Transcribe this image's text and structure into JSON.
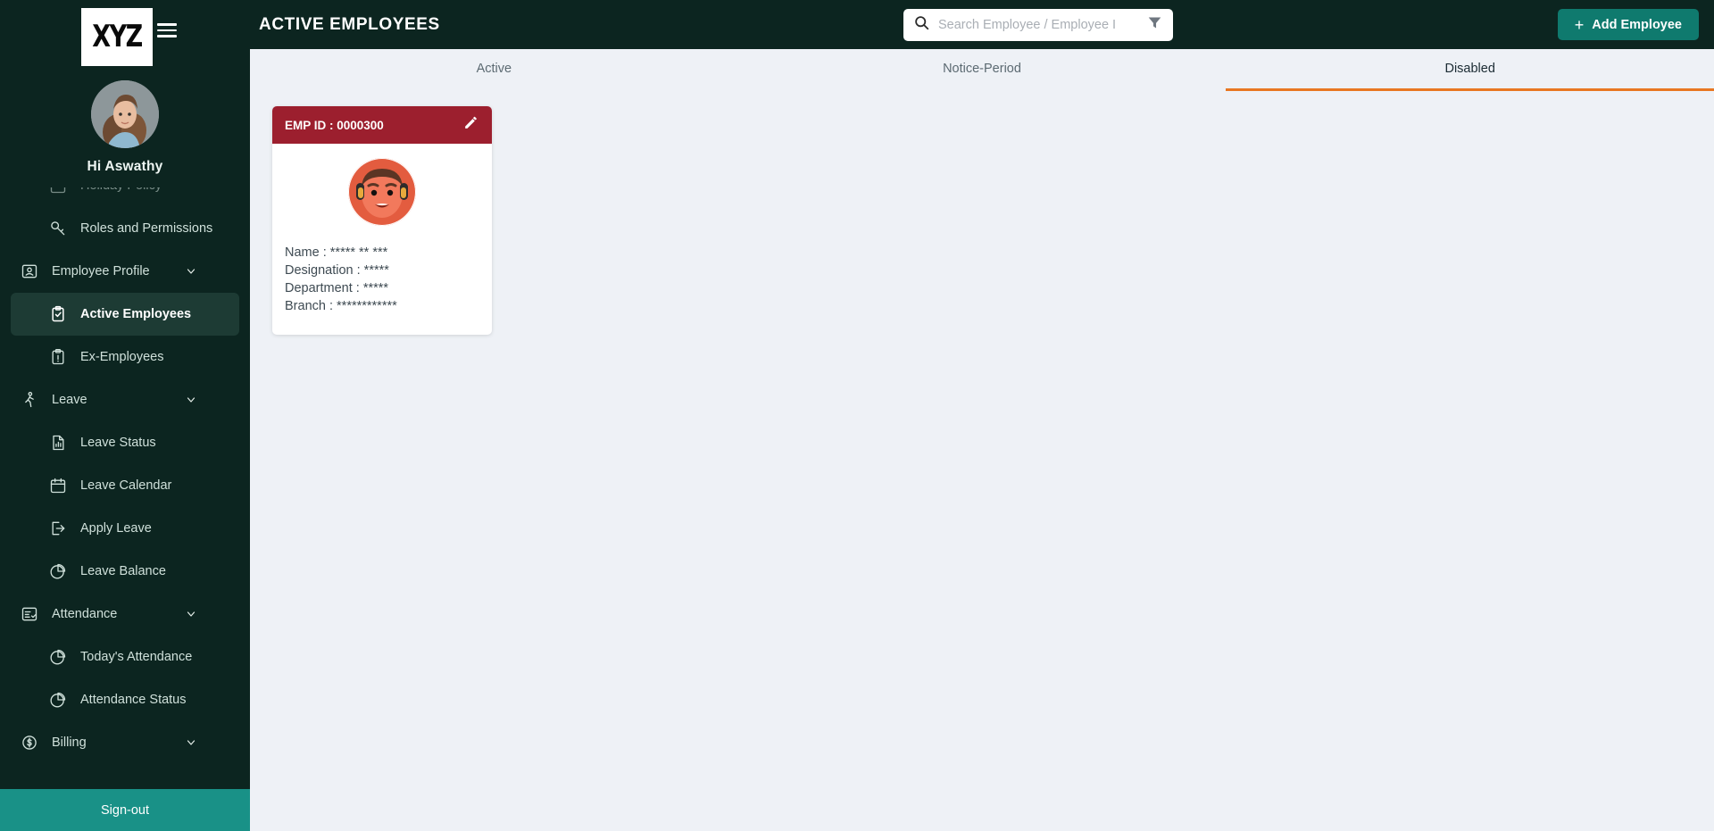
{
  "sidebar": {
    "logo_text": "XYZ",
    "menu_icon": "hamburger-icon",
    "greeting": "Hi Aswathy",
    "signout_label": "Sign-out",
    "items": [
      {
        "label": "Holiday Policy",
        "icon": "calendar-icon",
        "level": "child",
        "active": false,
        "chevron": false,
        "clipped": true
      },
      {
        "label": "Roles and Permissions",
        "icon": "key-icon",
        "level": "child",
        "active": false,
        "chevron": false
      },
      {
        "label": "Employee Profile",
        "icon": "id-card-icon",
        "level": "parent",
        "active": false,
        "chevron": true
      },
      {
        "label": "Active Employees",
        "icon": "clipboard-check-icon",
        "level": "child",
        "active": true,
        "chevron": false
      },
      {
        "label": "Ex-Employees",
        "icon": "clipboard-alert-icon",
        "level": "child",
        "active": false,
        "chevron": false
      },
      {
        "label": "Leave",
        "icon": "walking-person-icon",
        "level": "parent",
        "active": false,
        "chevron": true
      },
      {
        "label": "Leave Status",
        "icon": "document-chart-icon",
        "level": "child",
        "active": false,
        "chevron": false
      },
      {
        "label": "Leave Calendar",
        "icon": "calendar-icon",
        "level": "child",
        "active": false,
        "chevron": false
      },
      {
        "label": "Apply Leave",
        "icon": "exit-arrow-icon",
        "level": "child",
        "active": false,
        "chevron": false
      },
      {
        "label": "Leave Balance",
        "icon": "pie-chart-icon",
        "level": "child",
        "active": false,
        "chevron": false
      },
      {
        "label": "Attendance",
        "icon": "list-check-icon",
        "level": "parent",
        "active": false,
        "chevron": true
      },
      {
        "label": "Today's Attendance",
        "icon": "pie-chart-icon",
        "level": "child",
        "active": false,
        "chevron": false
      },
      {
        "label": "Attendance Status",
        "icon": "pie-chart-icon",
        "level": "child",
        "active": false,
        "chevron": false
      },
      {
        "label": "Billing",
        "icon": "dollar-circle-icon",
        "level": "parent",
        "active": false,
        "chevron": true
      }
    ]
  },
  "header": {
    "title": "ACTIVE EMPLOYEES",
    "search": {
      "placeholder": "Search Employee / Employee I",
      "value": "",
      "search_icon": "search-icon",
      "filter_icon": "funnel-filter-icon"
    },
    "add_button": {
      "label": "Add Employee",
      "icon": "plus-icon"
    }
  },
  "tabs": [
    {
      "label": "Active",
      "selected": false
    },
    {
      "label": "Notice-Period",
      "selected": false
    },
    {
      "label": "Disabled",
      "selected": true
    }
  ],
  "employee_cards": [
    {
      "emp_id_label": "EMP ID : 0000300",
      "edit_icon": "pencil-edit-icon",
      "photo": "employee-avatar",
      "fields": [
        {
          "label": "Name :",
          "value": "***** ** ***"
        },
        {
          "label": "Designation :",
          "value": "*****"
        },
        {
          "label": "Department :",
          "value": "*****"
        },
        {
          "label": "Branch :",
          "value": "************"
        }
      ]
    }
  ],
  "colors": {
    "sidebar_bg": "#0c2520",
    "accent_teal": "#0f7a6e",
    "signout_teal": "#199187",
    "tab_underline": "#e87722",
    "card_header_red": "#9c1f2e",
    "content_bg": "#eef1f6"
  }
}
